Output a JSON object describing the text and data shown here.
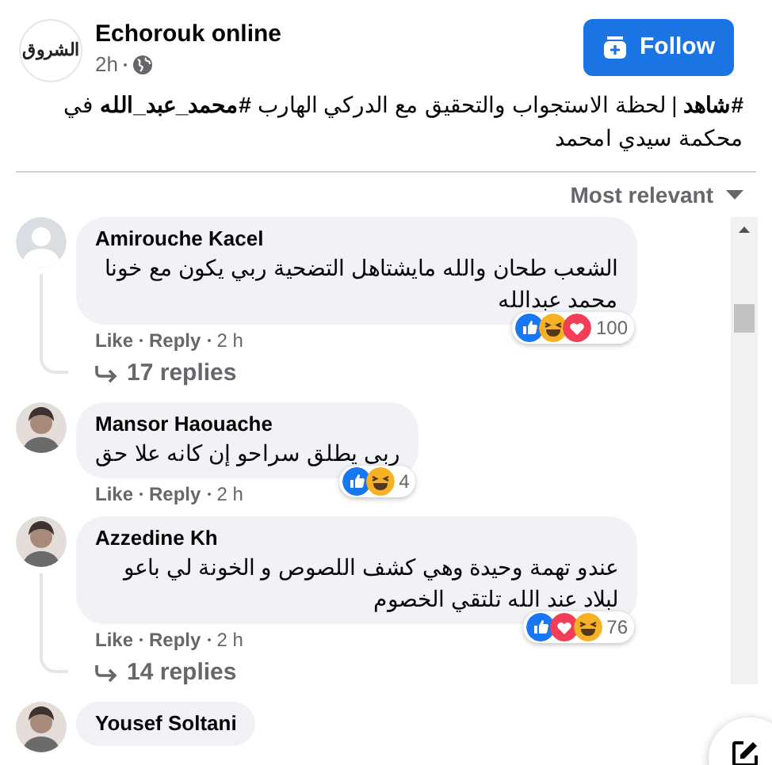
{
  "post": {
    "logo_text": "الشروق",
    "page_name": "Echorouk online",
    "time": "2h",
    "follow_label": "Follow",
    "text": "**#شاهد** | لحظة الاستجواب والتحقيق مع الدركي الهارب **#محمد_عبد_الله** في محكمة سيدي امحمد"
  },
  "sort": {
    "label": "Most relevant"
  },
  "comments": [
    {
      "author": "Amirouche Kacel",
      "avatar": {
        "kind": "placeholder"
      },
      "text": "الشعب طحان والله مايشتاهل التضحية ربي يكون مع خونا محمد عبدالله",
      "reactions": [
        {
          "kind": "like"
        },
        {
          "kind": "haha"
        },
        {
          "kind": "love"
        }
      ],
      "count": "100",
      "like": "Like",
      "reply": "Reply",
      "time": "2 h",
      "replies": "17 replies"
    },
    {
      "author": "Mansor Haouache",
      "avatar": {
        "kind": "picture"
      },
      "text": "ربى يطلق سراحو إن كانه علا حق",
      "reactions": [
        {
          "kind": "like"
        },
        {
          "kind": "haha"
        }
      ],
      "count": "4",
      "like": "Like",
      "reply": "Reply",
      "time": "2 h"
    },
    {
      "author": "Azzedine Kh",
      "avatar": {
        "kind": "picture"
      },
      "text": "عندو تهمة وحيدة وهي كشف اللصوص و الخونة لي باعو لبلاد عند الله تلتقي الخصوم",
      "reactions": [
        {
          "kind": "like"
        },
        {
          "kind": "love"
        },
        {
          "kind": "haha"
        }
      ],
      "count": "76",
      "like": "Like",
      "reply": "Reply",
      "time": "2 h",
      "replies": "14 replies"
    },
    {
      "author": "Yousef Soltani",
      "avatar": {
        "kind": "picture"
      }
    }
  ]
}
